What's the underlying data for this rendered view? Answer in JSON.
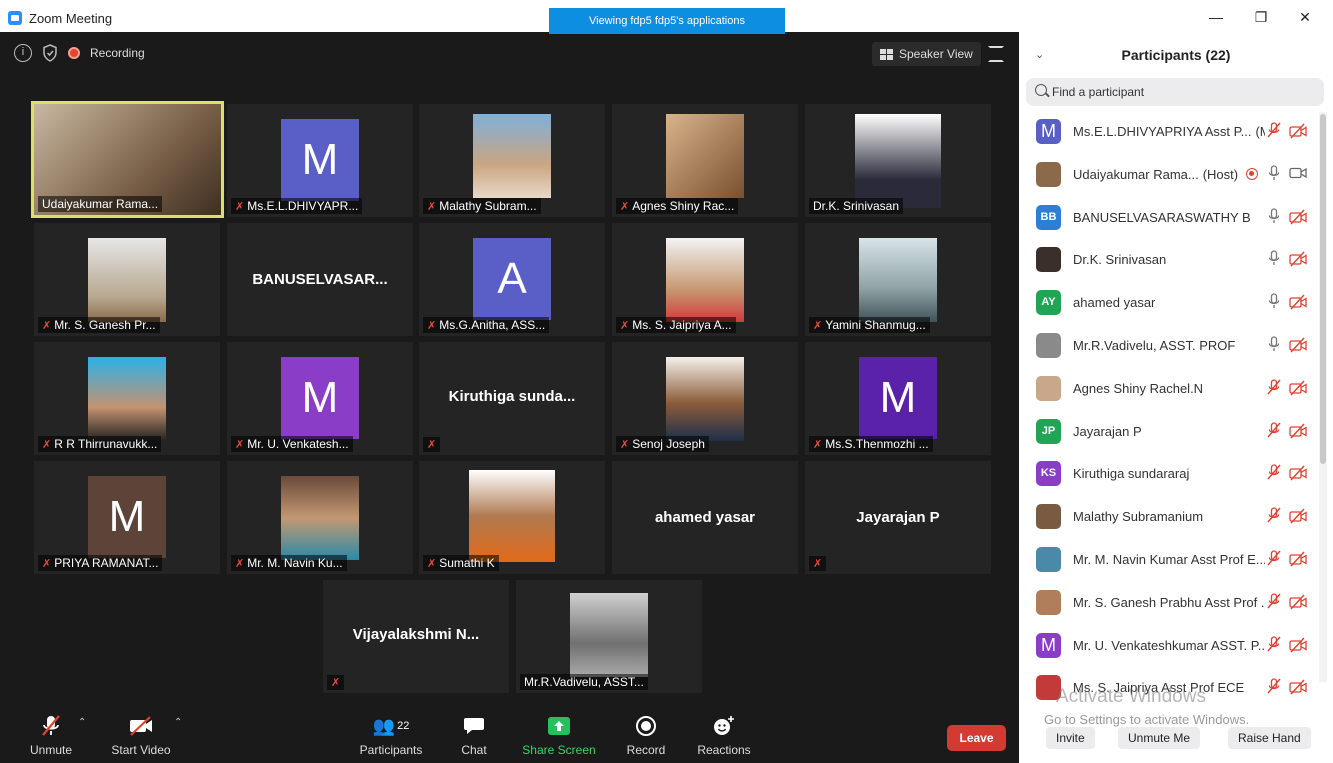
{
  "window": {
    "title": "Zoom Meeting",
    "viewing_banner": "Viewing fdp5 fdp5's applications"
  },
  "meeting": {
    "recording_label": "Recording",
    "speaker_view_label": "Speaker View",
    "tiles": [
      {
        "name": "Udaiyakumar Rama...",
        "muted": false,
        "active": true
      },
      {
        "name": "Ms.E.L.DHIVYAPR...",
        "muted": true,
        "avatar": "M"
      },
      {
        "name": "Malathy Subram...",
        "muted": true
      },
      {
        "name": "Agnes Shiny Rac...",
        "muted": true
      },
      {
        "name": "Dr.K. Srinivasan",
        "muted": false
      },
      {
        "name": "Mr. S. Ganesh Pr...",
        "muted": true
      },
      {
        "name": "",
        "big_name": "BANUSELVASAR...",
        "muted": false
      },
      {
        "name": "Ms.G.Anitha, ASS...",
        "muted": true,
        "avatar": "A"
      },
      {
        "name": "Ms. S. Jaipriya A...",
        "muted": true
      },
      {
        "name": "Yamini Shanmug...",
        "muted": true
      },
      {
        "name": "R R Thirrunavukk...",
        "muted": true
      },
      {
        "name": "Mr. U. Venkatesh...",
        "muted": true,
        "avatar": "M"
      },
      {
        "name": "",
        "big_name": "Kiruthiga  sunda...",
        "muted": true
      },
      {
        "name": "Senoj Joseph",
        "muted": true
      },
      {
        "name": "Ms.S.Thenmozhi ...",
        "muted": true,
        "avatar": "M"
      },
      {
        "name": "PRIYA RAMANAT...",
        "muted": true,
        "avatar": "M"
      },
      {
        "name": "Mr. M. Navin Ku...",
        "muted": true
      },
      {
        "name": "Sumathi K",
        "muted": true
      },
      {
        "name": "",
        "big_name": "ahamed yasar",
        "muted": false
      },
      {
        "name": "",
        "big_name": "Jayarajan P",
        "muted": true
      },
      {
        "name": "",
        "big_name": "Vijayalakshmi  N...",
        "muted": true
      },
      {
        "name": "Mr.R.Vadivelu, ASST...",
        "muted": false
      }
    ]
  },
  "toolbar": {
    "unmute": "Unmute",
    "start_video": "Start Video",
    "participants": "Participants",
    "participants_count": "22",
    "chat": "Chat",
    "share_screen": "Share Screen",
    "record": "Record",
    "reactions": "Reactions",
    "leave": "Leave"
  },
  "panel": {
    "title": "Participants (22)",
    "search_placeholder": "Find a participant",
    "participants": [
      {
        "name": "Ms.E.L.DHIVYAPRIYA Asst P...",
        "tag": "(Me)",
        "initials": "M",
        "color": "#5a5fc8",
        "mic": "off",
        "cam": "off"
      },
      {
        "name": "Udaiyakumar Rama...",
        "tag": "(Host)",
        "initials": "",
        "color": "#8a6a4a",
        "mic": "on",
        "cam": "on",
        "recording": true
      },
      {
        "name": "BANUSELVASARASWATHY B",
        "initials": "BB",
        "color": "#2d7fd6",
        "mic": "on",
        "cam": "off"
      },
      {
        "name": "Dr.K. Srinivasan",
        "initials": "",
        "color": "#3a2f2a",
        "mic": "on",
        "cam": "off"
      },
      {
        "name": "ahamed yasar",
        "initials": "AY",
        "color": "#22a455",
        "mic": "on",
        "cam": "off"
      },
      {
        "name": "Mr.R.Vadivelu, ASST. PROF",
        "initials": "",
        "color": "#8a8a8a",
        "mic": "on",
        "cam": "off"
      },
      {
        "name": "Agnes Shiny Rachel.N",
        "initials": "",
        "color": "#c9a78a",
        "mic": "off",
        "cam": "off"
      },
      {
        "name": "Jayarajan P",
        "initials": "JP",
        "color": "#22a455",
        "mic": "off",
        "cam": "off"
      },
      {
        "name": "Kiruthiga sundararaj",
        "initials": "KS",
        "color": "#8a3ec8",
        "mic": "off",
        "cam": "off"
      },
      {
        "name": "Malathy Subramanium",
        "initials": "",
        "color": "#7a5a40",
        "mic": "off",
        "cam": "off"
      },
      {
        "name": "Mr. M. Navin Kumar Asst Prof E...",
        "initials": "",
        "color": "#4a8aa8",
        "mic": "off",
        "cam": "off"
      },
      {
        "name": "Mr. S. Ganesh Prabhu Asst Prof ...",
        "initials": "",
        "color": "#b07e5a",
        "mic": "off",
        "cam": "off"
      },
      {
        "name": "Mr. U. Venkateshkumar ASST. P...",
        "initials": "M",
        "color": "#8a3ec8",
        "mic": "off",
        "cam": "off"
      },
      {
        "name": "Ms. S. Jaipriya Asst Prof ECE",
        "initials": "",
        "color": "#c23a3a",
        "mic": "off",
        "cam": "off"
      }
    ],
    "watermark_title": "Activate Windows",
    "watermark_sub": "Go to Settings to activate Windows.",
    "invite": "Invite",
    "unmute_me": "Unmute Me",
    "raise_hand": "Raise Hand"
  }
}
